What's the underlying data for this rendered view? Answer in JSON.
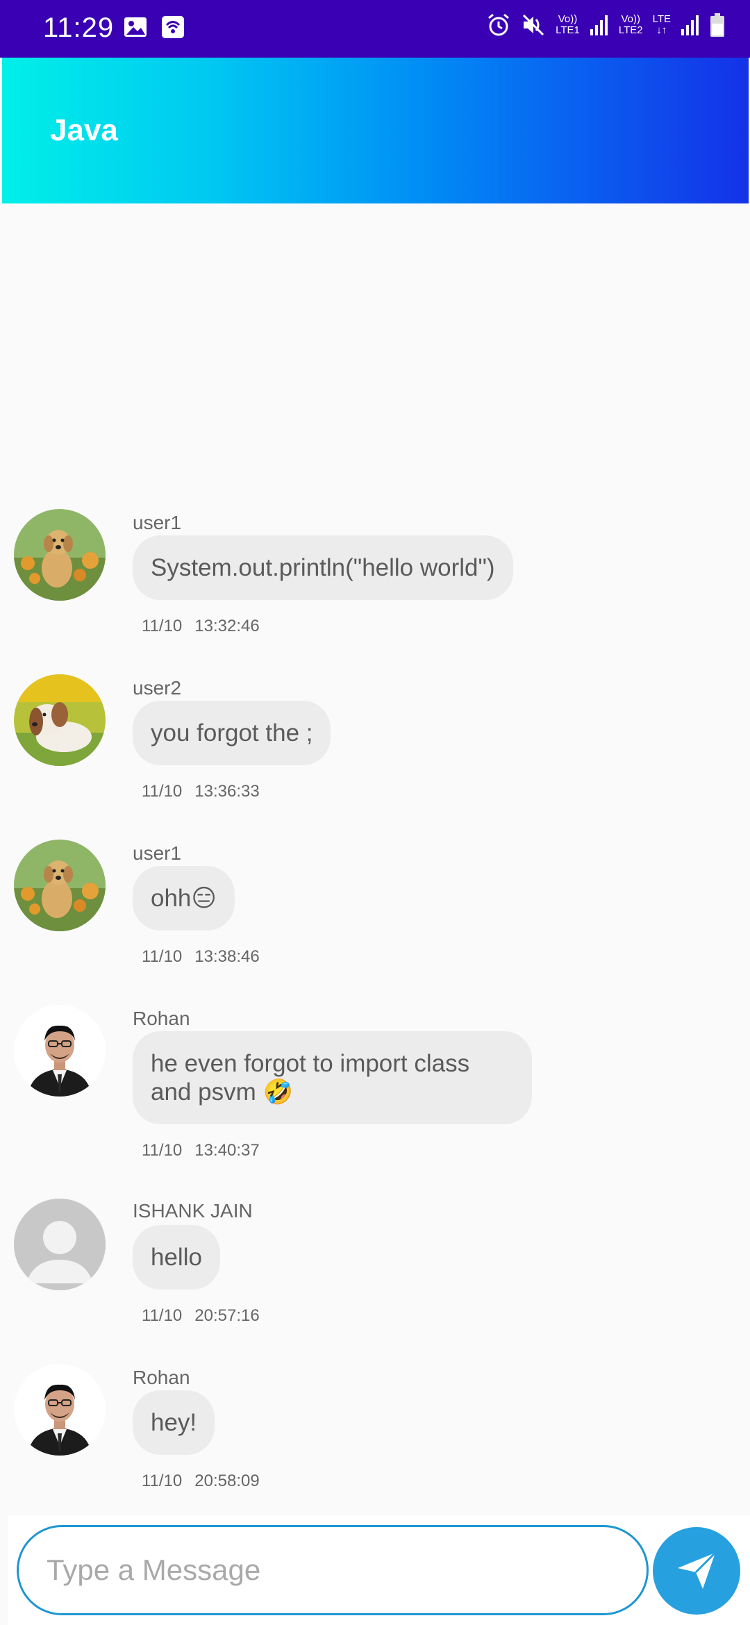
{
  "status_bar": {
    "time": "11:29",
    "icons": [
      "image-icon",
      "wifi-hotspot-icon",
      "alarm-icon",
      "mute-icon",
      "volte-lte1-icon",
      "signal-icon",
      "volte-lte2-icon",
      "lte-icon",
      "signal-icon",
      "battery-icon"
    ],
    "lte1_text": "Vo))",
    "lte1_sub": "LTE1",
    "lte2_text": "Vo))",
    "lte2_sub": "LTE2",
    "lte_text": "LTE"
  },
  "app_bar": {
    "title": "Java",
    "gradient": [
      "#00f0e8",
      "#1432e8"
    ]
  },
  "messages": [
    {
      "user": "user1",
      "avatar": "golden-puppy-avatar",
      "text": "System.out.println(\"hello world\")",
      "date": "11/10",
      "time": "13:32:46"
    },
    {
      "user": "user2",
      "avatar": "beagle-avatar",
      "text": "you forgot the ;",
      "date": "11/10",
      "time": "13:36:33"
    },
    {
      "user": "user1",
      "avatar": "golden-puppy-avatar",
      "text": "ohh",
      "emoji": "😑",
      "date": "11/10",
      "time": "13:38:46"
    },
    {
      "user": "Rohan",
      "avatar": "man-portrait-avatar",
      "text": "he even forgot to import class and psvm",
      "emoji": "🤣",
      "date": "11/10",
      "time": "13:40:37"
    },
    {
      "user": "ISHANK JAIN",
      "avatar": "default-person-avatar",
      "text": "hello",
      "date": "11/10",
      "time": "20:57:16"
    },
    {
      "user": "Rohan",
      "avatar": "man-portrait-avatar",
      "text": "hey!",
      "date": "11/10",
      "time": "20:58:09"
    }
  ],
  "composer": {
    "placeholder": "Type a Message",
    "value": "",
    "send_icon": "paper-plane-icon",
    "accent": "#26a0df"
  }
}
